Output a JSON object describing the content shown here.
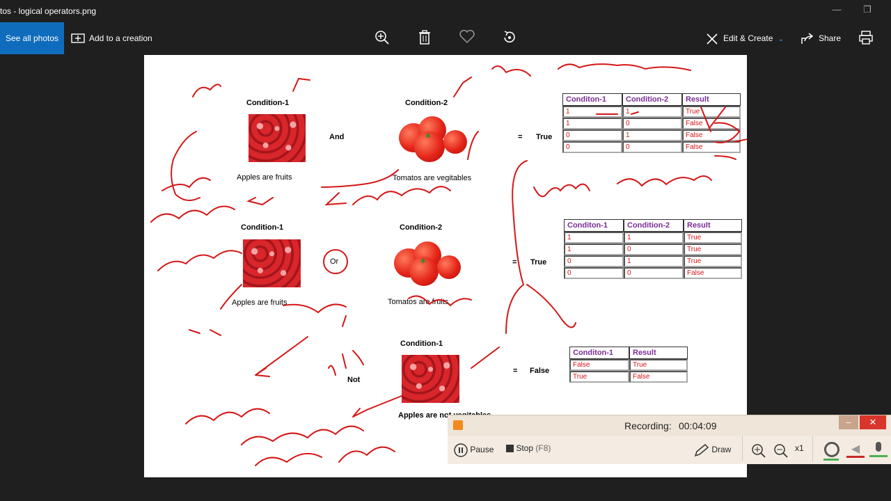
{
  "window": {
    "title": "tos - logical operators.png",
    "minimize": "—",
    "restore": "❐"
  },
  "toolbar": {
    "see_all": "See all photos",
    "add_creation": "Add to a creation",
    "edit_create": "Edit & Create",
    "share": "Share",
    "icons": [
      "zoom-in-icon",
      "delete-icon",
      "favorite-icon",
      "rotate-icon",
      "print-icon"
    ]
  },
  "image": {
    "section_and": {
      "cond1": "Condition-1",
      "cond2": "Condition-2",
      "op": "And",
      "eq": "=",
      "res": "True",
      "cap1": "Apples are fruits",
      "cap2": "Tomatos are vegitables"
    },
    "section_or": {
      "cond1": "Condition-1",
      "cond2": "Condition-2",
      "op": "Or",
      "eq": "=",
      "res": "True",
      "cap1": "Apples are fruits",
      "cap2": "Tomatos are fruits"
    },
    "section_not": {
      "cond1": "Condition-1",
      "op": "Not",
      "eq": "=",
      "res": "False",
      "cap1": "Apples are not vegitables"
    },
    "table_and": {
      "headers": [
        "Conditon-1",
        "Condition-2",
        "Result"
      ],
      "rows": [
        [
          "1",
          "1",
          "True"
        ],
        [
          "1",
          "0",
          "False"
        ],
        [
          "0",
          "1",
          "False"
        ],
        [
          "0",
          "0",
          "False"
        ]
      ]
    },
    "table_or": {
      "headers": [
        "Conditon-1",
        "Condition-2",
        "Result"
      ],
      "rows": [
        [
          "1",
          "1",
          "True"
        ],
        [
          "1",
          "0",
          "True"
        ],
        [
          "0",
          "1",
          "True"
        ],
        [
          "0",
          "0",
          "False"
        ]
      ]
    },
    "table_not": {
      "headers": [
        "Conditon-1",
        "Result"
      ],
      "rows": [
        [
          "False",
          "True"
        ],
        [
          "True",
          "False"
        ]
      ]
    }
  },
  "recorder": {
    "label": "Recording:",
    "time": "00:04:09",
    "pause": "Pause",
    "stop": "Stop",
    "stop_key": "(F8)",
    "draw": "Draw",
    "zoom": "x1"
  },
  "colors": {
    "accent": "#0f6cbd",
    "ink": "#d41616",
    "header": "#7a2d95"
  }
}
